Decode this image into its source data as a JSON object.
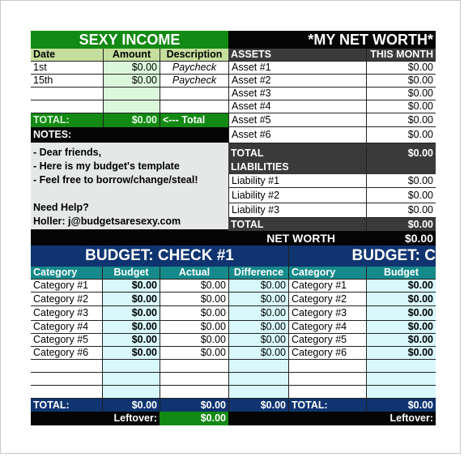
{
  "income": {
    "title": "SEXY INCOME",
    "headers": [
      "Date",
      "Amount",
      "Description"
    ],
    "rows": [
      {
        "date": "1st",
        "amount": "$0.00",
        "description": "Paycheck"
      },
      {
        "date": "15th",
        "amount": "$0.00",
        "description": "Paycheck"
      },
      {
        "date": "",
        "amount": "",
        "description": ""
      },
      {
        "date": "",
        "amount": "",
        "description": ""
      }
    ],
    "total_label": "TOTAL:",
    "total_amount": "$0.00",
    "total_note": "<--- Total"
  },
  "notes": {
    "label": "NOTES:",
    "lines": [
      "- Dear friends,",
      "- Here is my budget's template",
      "- Feel free to borrow/change/steal!",
      "",
      "Need Help?",
      "Holler: j@budgetsaresexy.com"
    ]
  },
  "net_worth": {
    "title": "*MY NET WORTH*",
    "assets_header": "ASSETS",
    "month_header": "THIS MONTH",
    "assets": [
      {
        "name": "Asset #1",
        "value": "$0.00"
      },
      {
        "name": "Asset #2",
        "value": "$0.00"
      },
      {
        "name": "Asset #3",
        "value": "$0.00"
      },
      {
        "name": "Asset #4",
        "value": "$0.00"
      },
      {
        "name": "Asset #5",
        "value": "$0.00"
      },
      {
        "name": "Asset #6",
        "value": "$0.00"
      }
    ],
    "assets_total_label": "TOTAL",
    "assets_total": "$0.00",
    "liabilities_header": "LIABILITIES",
    "liabilities": [
      {
        "name": "Liability #1",
        "value": "$0.00"
      },
      {
        "name": "Liability #2",
        "value": "$0.00"
      },
      {
        "name": "Liability #3",
        "value": "$0.00"
      }
    ],
    "liabilities_total_label": "TOTAL",
    "liabilities_total": "$0.00",
    "net_worth_label": "NET WORTH",
    "net_worth_value": "$0.00"
  },
  "budget1": {
    "title": "BUDGET: CHECK #1",
    "headers": [
      "Category",
      "Budget",
      "Actual",
      "Difference"
    ],
    "rows": [
      {
        "category": "Category #1",
        "budget": "$0.00",
        "actual": "$0.00",
        "difference": "$0.00"
      },
      {
        "category": "Category #2",
        "budget": "$0.00",
        "actual": "$0.00",
        "difference": "$0.00"
      },
      {
        "category": "Category #3",
        "budget": "$0.00",
        "actual": "$0.00",
        "difference": "$0.00"
      },
      {
        "category": "Category #4",
        "budget": "$0.00",
        "actual": "$0.00",
        "difference": "$0.00"
      },
      {
        "category": "Category #5",
        "budget": "$0.00",
        "actual": "$0.00",
        "difference": "$0.00"
      },
      {
        "category": "Category #6",
        "budget": "$0.00",
        "actual": "$0.00",
        "difference": "$0.00"
      },
      {
        "category": "",
        "budget": "",
        "actual": "",
        "difference": ""
      },
      {
        "category": "",
        "budget": "",
        "actual": "",
        "difference": ""
      },
      {
        "category": "",
        "budget": "",
        "actual": "",
        "difference": ""
      }
    ],
    "total_label": "TOTAL:",
    "total_budget": "$0.00",
    "total_actual": "$0.00",
    "total_difference": "$0.00",
    "leftover_label": "Leftover:",
    "leftover_value": "$0.00"
  },
  "budget2": {
    "title": "BUDGET: C",
    "headers": [
      "Category",
      "Budget"
    ],
    "rows": [
      {
        "category": "Category #1",
        "budget": "$0.00"
      },
      {
        "category": "Category #2",
        "budget": "$0.00"
      },
      {
        "category": "Category #3",
        "budget": "$0.00"
      },
      {
        "category": "Category #4",
        "budget": "$0.00"
      },
      {
        "category": "Category #5",
        "budget": "$0.00"
      },
      {
        "category": "Category #6",
        "budget": "$0.00"
      },
      {
        "category": "",
        "budget": ""
      },
      {
        "category": "",
        "budget": ""
      },
      {
        "category": "",
        "budget": ""
      }
    ],
    "total_label": "TOTAL:",
    "total_budget": "$0.00",
    "leftover_label": "Leftover:"
  },
  "colors": {
    "income_green": "#138a13",
    "income_header": "#c4df9b",
    "income_amount_bg": "#dcf8dc",
    "notes_bg": "#e6e8e8",
    "dark_gray": "#3a3a3a",
    "budget_blue": "#0f3470",
    "budget_teal": "#168a8a",
    "budget_cyan": "#d8f8fc"
  }
}
